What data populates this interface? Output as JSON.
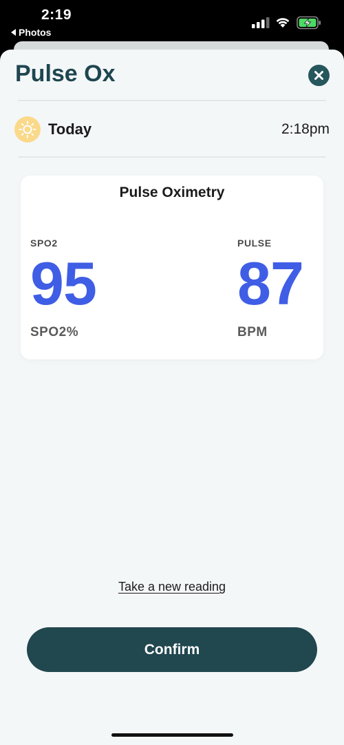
{
  "status_bar": {
    "time": "2:19",
    "back_app": "Photos",
    "icons": [
      "signal-icon",
      "wifi-icon",
      "battery-charging-icon"
    ]
  },
  "header": {
    "title": "Pulse Ox",
    "close_icon": "close-icon"
  },
  "reading_time": {
    "icon": "sun-icon",
    "day": "Today",
    "time": "2:18pm"
  },
  "card": {
    "title": "Pulse Oximetry",
    "spo2": {
      "label": "SPO2",
      "value": "95",
      "unit": "SPO2%"
    },
    "pulse": {
      "label": "PULSE",
      "value": "87",
      "unit": "BPM"
    }
  },
  "actions": {
    "new_reading_link": "Take a new reading",
    "confirm_label": "Confirm"
  },
  "colors": {
    "title": "#1f4650",
    "accent_value": "#3f5ee5",
    "confirm_bg": "#21474f",
    "close_bg": "#26575c",
    "sun_badge": "#fad98a",
    "sheet_bg": "#f4f7f8"
  }
}
